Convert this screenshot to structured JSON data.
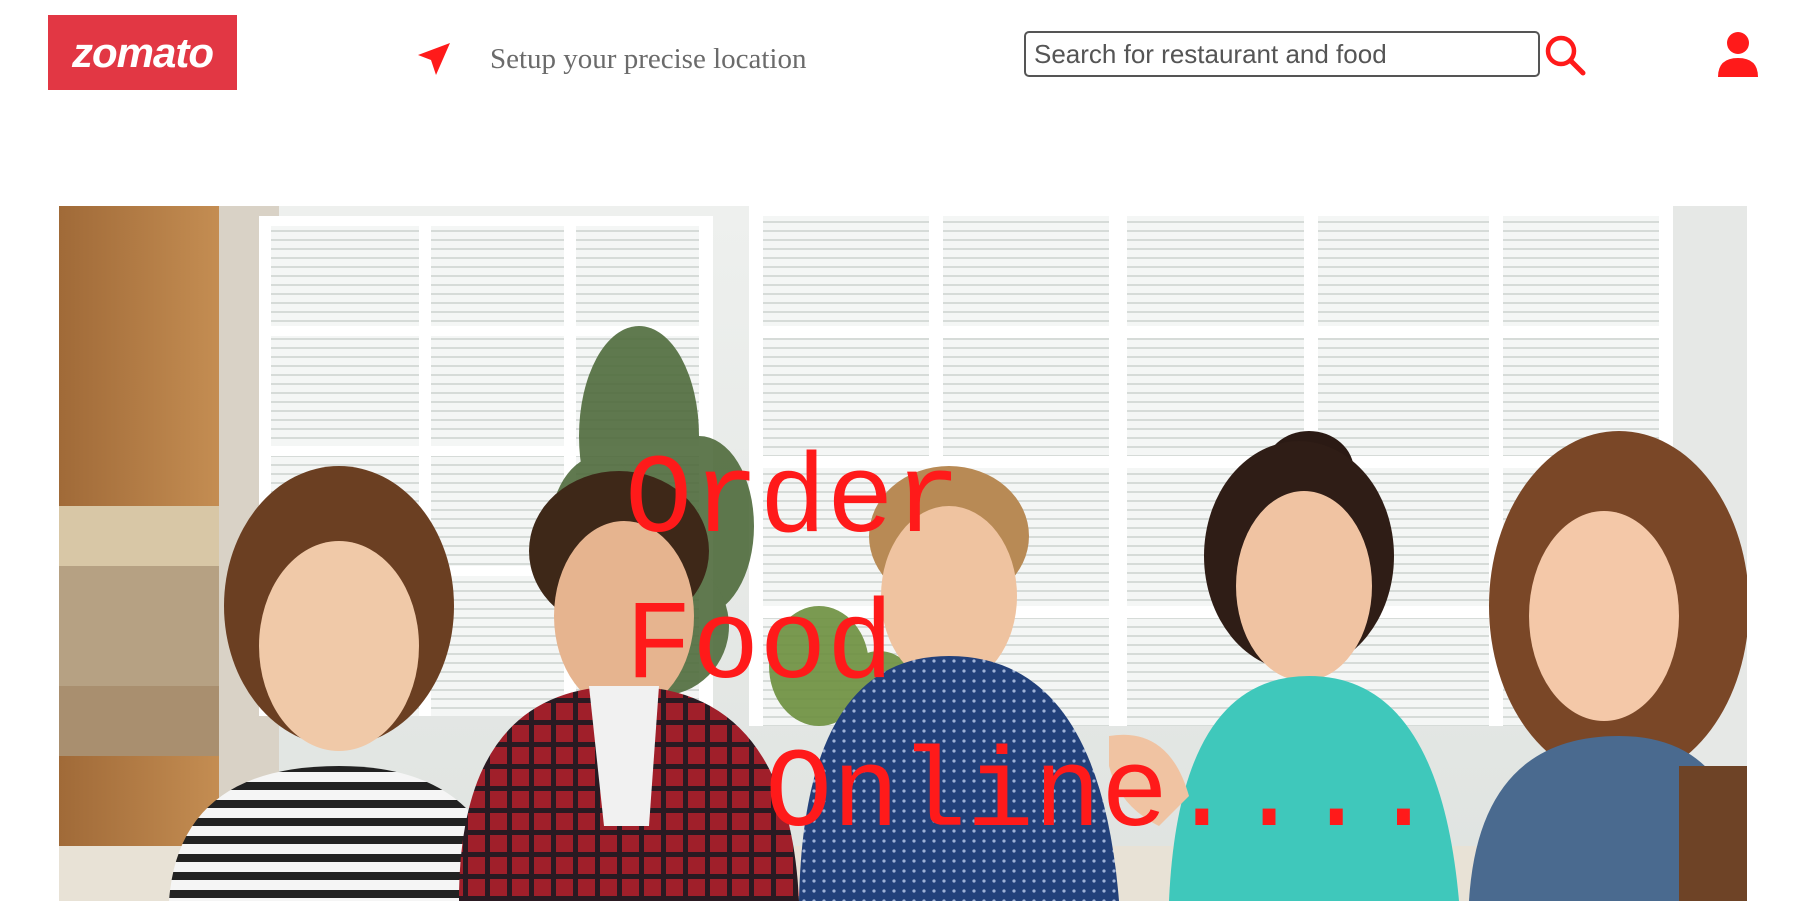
{
  "header": {
    "logo_text": "zomato",
    "location_text": "Setup your precise location",
    "location_icon": "navigation-arrow-icon",
    "search": {
      "placeholder": "Search for restaurant and food",
      "value": "",
      "icon": "search-icon"
    },
    "user_icon": "user-icon"
  },
  "hero": {
    "headline": [
      "Order",
      "Food",
      "Online...."
    ]
  },
  "colors": {
    "brand": "#e23744",
    "accent": "#ff1a1a",
    "location_text": "#6b6b6b"
  }
}
